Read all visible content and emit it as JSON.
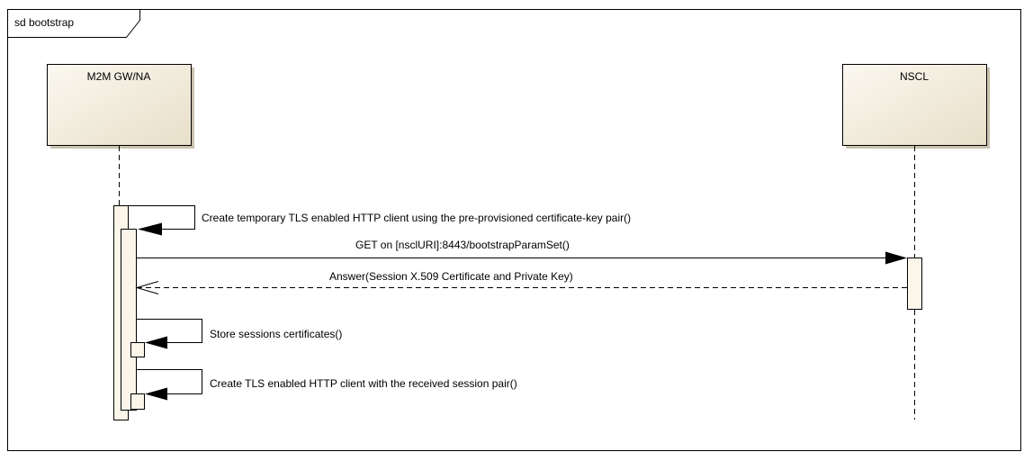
{
  "frame": {
    "title": "sd bootstrap"
  },
  "lifelines": [
    {
      "id": "gw",
      "name": "M2M GW/NA"
    },
    {
      "id": "nscl",
      "name": "NSCL"
    }
  ],
  "messages": [
    {
      "id": "m1",
      "from": "gw",
      "to": "gw",
      "kind": "self-sync",
      "label": "Create temporary TLS enabled HTTP client using the pre-provisioned certificate-key pair()"
    },
    {
      "id": "m2",
      "from": "gw",
      "to": "nscl",
      "kind": "sync",
      "label": "GET on [nsclURI]:8443/bootstrapParamSet()"
    },
    {
      "id": "m3",
      "from": "nscl",
      "to": "gw",
      "kind": "return",
      "label": "Answer(Session X.509 Certificate and Private Key)"
    },
    {
      "id": "m4",
      "from": "gw",
      "to": "gw",
      "kind": "self-sync",
      "label": "Store sessions certificates()"
    },
    {
      "id": "m5",
      "from": "gw",
      "to": "gw",
      "kind": "self-sync",
      "label": "Create TLS enabled HTTP client with the received session pair()"
    }
  ],
  "colors": {
    "lifeline_fill": "#EDE6D4",
    "lifeline_fill_light": "#FAF6EC",
    "activation_fill": "#FCF5EA",
    "line": "#000000"
  }
}
